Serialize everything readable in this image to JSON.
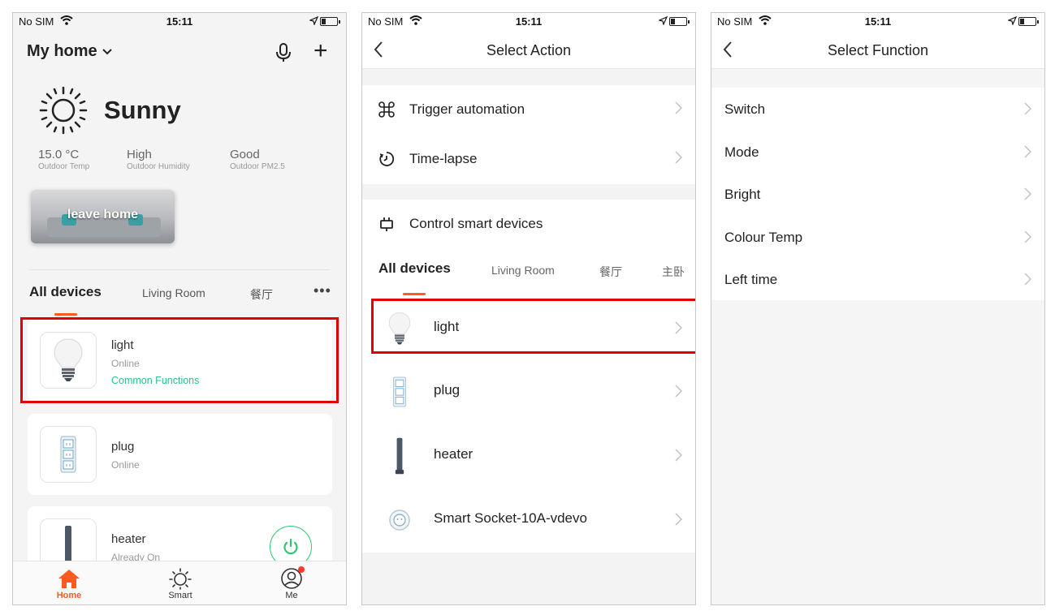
{
  "status": {
    "carrier": "No SIM",
    "time": "15:11"
  },
  "phone1": {
    "home_title": "My home",
    "weather": {
      "condition": "Sunny"
    },
    "stats": [
      {
        "value": "15.0 °C",
        "label": "Outdoor Temp"
      },
      {
        "value": "High",
        "label": "Outdoor Humidity"
      },
      {
        "value": "Good",
        "label": "Outdoor PM2.5"
      }
    ],
    "scene_label": "leave home",
    "tabs": [
      "All devices",
      "Living Room",
      "餐厅"
    ],
    "more": "•••",
    "devices": [
      {
        "name": "light",
        "status": "Online",
        "functions": "Common Functions"
      },
      {
        "name": "plug",
        "status": "Online"
      },
      {
        "name": "heater",
        "status": "Already On"
      }
    ],
    "tabbar": [
      "Home",
      "Smart",
      "Me"
    ]
  },
  "phone2": {
    "title": "Select Action",
    "actions": [
      "Trigger automation",
      "Time-lapse"
    ],
    "control": "Control smart devices",
    "tabs": [
      "All devices",
      "Living Room",
      "餐厅",
      "主卧"
    ],
    "devices": [
      "light",
      "plug",
      "heater",
      "Smart Socket-10A-vdevo"
    ]
  },
  "phone3": {
    "title": "Select Function",
    "functions": [
      "Switch",
      "Mode",
      "Bright",
      "Colour Temp",
      "Left time"
    ]
  },
  "colors": {
    "accent": "#ff5a1f",
    "online_green": "#2cc08f",
    "highlight": "#e30000"
  }
}
